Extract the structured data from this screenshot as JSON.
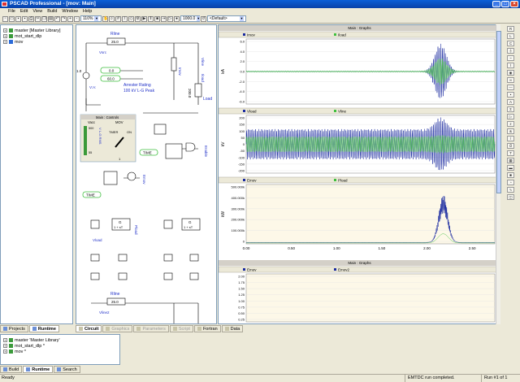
{
  "window": {
    "title": "PSCAD Professional - [mov: Main]"
  },
  "menu": [
    "File",
    "Edit",
    "View",
    "Build",
    "Window",
    "Help"
  ],
  "toolbar": {
    "zoom_value": "110%",
    "time_value": "1000.0",
    "palette_value": "<Default>"
  },
  "workspace": {
    "items": [
      {
        "label": "master [Master Library]",
        "expander": "+"
      },
      {
        "label": "mot_start_dlp",
        "expander": "+"
      },
      {
        "label": "mov",
        "expander": "+"
      }
    ]
  },
  "left_tabs": [
    {
      "label": "Projects",
      "active": false
    },
    {
      "label": "Runtime",
      "active": true
    }
  ],
  "circuit": {
    "labels": {
      "rline": "Rline",
      "rline_value": "25.0",
      "vsrc": "Vsrc",
      "imov": "Imov",
      "vline": "Vline",
      "iload": "Iload",
      "load": "Load",
      "val_00": "0.0",
      "val_600": "60.0",
      "val_10": "1.0",
      "vac": "V:A:",
      "r_200": "200.0",
      "arrester_line1": "Arrester Rating",
      "arrester_line2": "100 kV L-G Peak",
      "time": "TIME",
      "enable": "Enable",
      "emov": "Emov",
      "g_transfer": "G",
      "g_denominator": "1 + sT",
      "vload": "Vload",
      "pload": "Pload",
      "rline_bottom": "Rline",
      "rline_bottom_value": "25.0",
      "vline2": "Vline2"
    },
    "controls": {
      "title": "Main : Controls",
      "col1_header": "Vacc",
      "col2_header": "MOV",
      "slider_top": "500",
      "slider_bottom": "55",
      "slider_label": "V L-G RMS",
      "timer_label": "TMER",
      "on_label": "ON",
      "button_value": "1"
    }
  },
  "graphs": {
    "window_title": "Main : Graphs",
    "window2_title": "Main : Graphs",
    "x_ticks": [
      "0.00",
      "0.50",
      "1.00",
      "1.50",
      "2.00",
      "2.50"
    ]
  },
  "chart_data": [
    {
      "type": "line",
      "ylabel": "kA",
      "series": [
        {
          "name": "Imov"
        },
        {
          "name": "Iload"
        }
      ],
      "yticks": [
        "6.0",
        "4.0",
        "2.0",
        "0.0",
        "-2.0",
        "-4.0",
        "-6.0"
      ],
      "ylim": [
        -6.5,
        6.5
      ],
      "xlim": [
        0,
        2.75
      ],
      "colors": [
        "#1a2aa0",
        "#3fbf3f"
      ]
    },
    {
      "type": "line",
      "ylabel": "kV",
      "series": [
        {
          "name": "Vload"
        },
        {
          "name": "Vline"
        }
      ],
      "yticks": [
        "200",
        "150",
        "100",
        "50",
        "0",
        "-50",
        "-100",
        "-150",
        "-200"
      ],
      "ylim": [
        -220,
        220
      ],
      "xlim": [
        0,
        2.75
      ],
      "colors": [
        "#1a2aa0",
        "#3fbf3f"
      ]
    },
    {
      "type": "line",
      "ylabel": "kW",
      "series": [
        {
          "name": "Emov"
        },
        {
          "name": "Pload"
        }
      ],
      "yticks": [
        "500.000k",
        "400.000k",
        "300.000k",
        "200.000k",
        "100.000k",
        "0"
      ],
      "ylim": [
        0,
        520000
      ],
      "xlim": [
        0,
        2.75
      ],
      "colors": [
        "#1a2aa0",
        "#3fbf3f"
      ],
      "background": "#fdf8e8"
    },
    {
      "type": "line",
      "series": [
        {
          "name": "Emov"
        },
        {
          "name": "Emov2"
        }
      ],
      "yticks": [
        "2.00",
        "1.75",
        "1.50",
        "1.25",
        "1.00",
        "0.75",
        "0.50",
        "0.25"
      ],
      "ylim": [
        0,
        2.1
      ],
      "background": "#fdf8e8"
    }
  ],
  "bottom_tabs": [
    {
      "label": "Circuit",
      "state": "active"
    },
    {
      "label": "Graphics",
      "state": "disabled"
    },
    {
      "label": "Parameters",
      "state": "disabled"
    },
    {
      "label": "Script",
      "state": "disabled"
    },
    {
      "label": "Fortran",
      "state": "normal"
    },
    {
      "label": "Data",
      "state": "normal"
    }
  ],
  "output_tree": [
    {
      "label": "master 'Master Library'"
    },
    {
      "label": "mot_start_dlp *"
    },
    {
      "label": "mov *"
    }
  ],
  "output_tabs": [
    {
      "label": "Build",
      "active": false
    },
    {
      "label": "Runtime",
      "active": true
    },
    {
      "label": "Search",
      "active": false
    }
  ],
  "status": {
    "left": "Ready",
    "message": "EMTDC run completed.",
    "run": "Run #1 of 1"
  }
}
